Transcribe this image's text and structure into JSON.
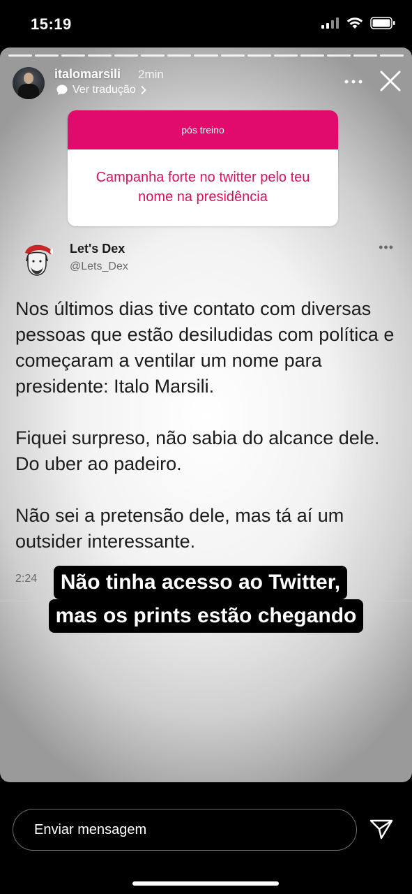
{
  "status_bar": {
    "time": "15:19"
  },
  "story": {
    "username": "italomarsili",
    "posted_ago": "2min",
    "translate_label": "Ver tradução",
    "question_box": {
      "header": "pós treino",
      "text": "Campanha forte no twitter pelo teu nome na presidência"
    },
    "tweet": {
      "name": "Let's Dex",
      "handle": "@Lets_Dex",
      "paragraphs": [
        "Nos últimos dias tive contato com diversas pessoas que estão desiludidas com política e começaram a ventilar um nome para presidente: Italo Marsili.",
        "Fiquei surpreso, não sabia do alcance dele. Do uber ao padeiro.",
        "Não sei a pretensão dele, mas tá aí um outsider interessante."
      ],
      "time_partial": "2:24"
    },
    "caption_lines": [
      "Não tinha acesso ao Twitter,",
      "mas os prints estão chegando"
    ]
  },
  "reply": {
    "placeholder": "Enviar mensagem"
  },
  "icons": {
    "more": "more-options-icon",
    "close": "close-icon",
    "translate": "speech-bubble-icon",
    "send": "send-icon"
  }
}
